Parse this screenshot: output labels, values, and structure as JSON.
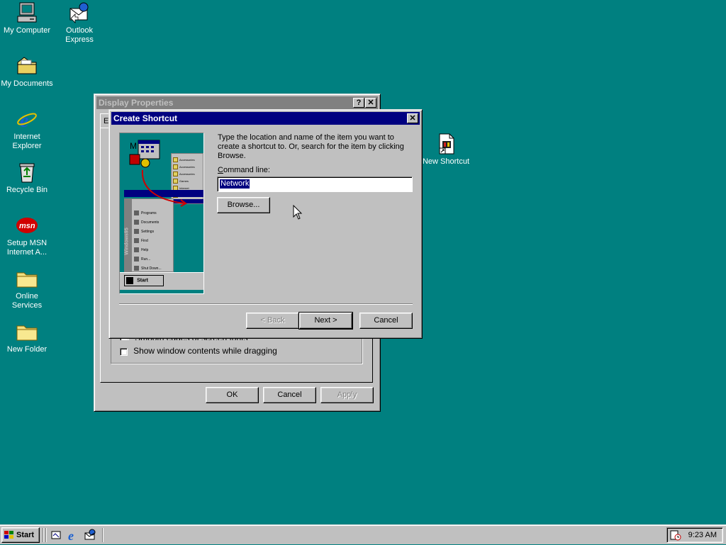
{
  "desktop": {
    "icons": [
      {
        "label": "My Computer"
      },
      {
        "label": "Outlook\nExpress"
      },
      {
        "label": "My Documents"
      },
      {
        "label": "Internet\nExplorer"
      },
      {
        "label": "Recycle Bin"
      },
      {
        "label": "Setup MSN\nInternet A..."
      },
      {
        "label": "Online\nServices"
      },
      {
        "label": "New Folder"
      },
      {
        "label": "New Shortcut"
      }
    ]
  },
  "display_properties": {
    "title": "Display Properties",
    "tab_partial": "E",
    "checkbox_partial": "Smooth edges of screen fonts",
    "show_window_contents": "Show window contents while dragging",
    "ok": "OK",
    "cancel": "Cancel",
    "apply": "Apply"
  },
  "create_shortcut": {
    "title": "Create Shortcut",
    "instructions": "Type the location and name of the item you want to create a shortcut to. Or, search for the item by clicking Browse.",
    "command_line_label": "Command line:",
    "command_line_value": "Network",
    "browse": "Browse...",
    "back": "< Back",
    "next": "Next >",
    "cancel": "Cancel",
    "illustration": {
      "menu_items": [
        "Programs",
        "Documents",
        "Settings",
        "Find",
        "Help",
        "Run...",
        "Shut Down..."
      ],
      "side_list": [
        "Accessories",
        "Accessories",
        "Accessories",
        "Games",
        "Internet",
        "Multimedia"
      ],
      "banner": "Windows95",
      "start_label": "Start"
    }
  },
  "taskbar": {
    "start": "Start",
    "clock": "9:23 AM"
  },
  "colors": {
    "desktop": "#008080",
    "titlebar_active": "#000080",
    "face": "#c0c0c0"
  }
}
